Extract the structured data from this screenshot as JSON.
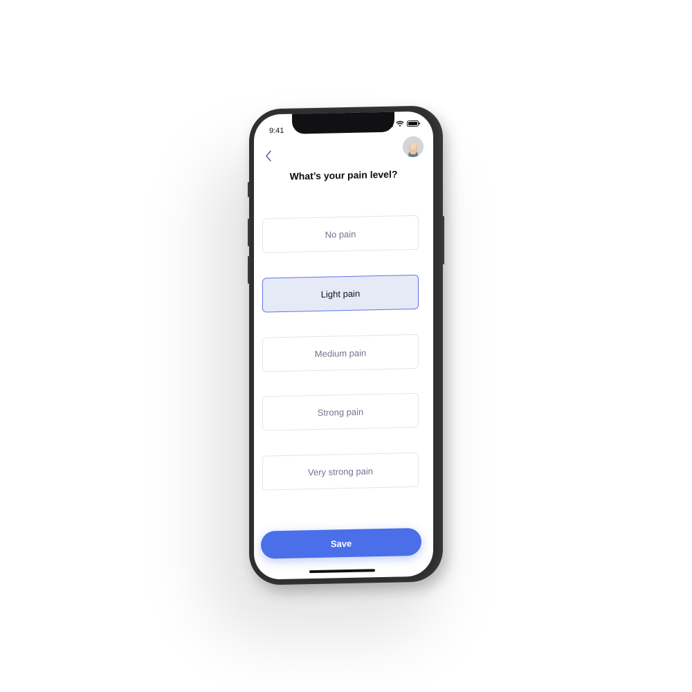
{
  "status": {
    "time": "9:41"
  },
  "header": {
    "title": "What’s your pain level?"
  },
  "options": [
    {
      "label": "No pain",
      "selected": false
    },
    {
      "label": "Light pain",
      "selected": true
    },
    {
      "label": "Medium pain",
      "selected": false
    },
    {
      "label": "Strong pain",
      "selected": false
    },
    {
      "label": "Very strong pain",
      "selected": false
    }
  ],
  "actions": {
    "save_label": "Save"
  },
  "icons": {
    "back": "chevron-left-icon",
    "signal": "cellular-signal-icon",
    "wifi": "wifi-icon",
    "battery": "battery-icon",
    "avatar": "user-avatar"
  },
  "colors": {
    "accent": "#4b6fe9",
    "selected_bg": "#e6eaf7",
    "selected_border": "#5b73e8",
    "option_text": "#6f7393",
    "phone_frame": "#2f2f31"
  }
}
